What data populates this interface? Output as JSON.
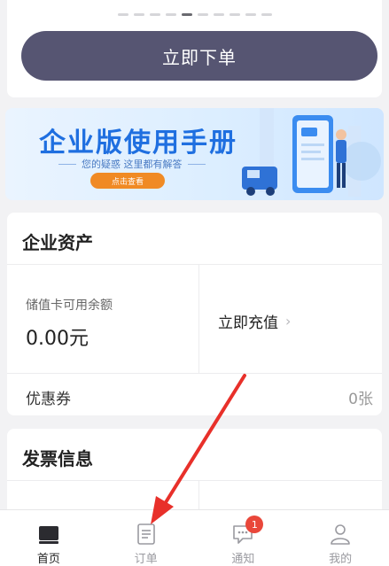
{
  "order": {
    "button_label": "立即下单",
    "pager_count": 10,
    "pager_active": 4
  },
  "banner": {
    "title": "企业版使用手册",
    "subtitle": "您的疑惑 这里都有解答",
    "button_label": "点击查看",
    "colors": {
      "title": "#1f6fe0",
      "button": "#f08a24"
    }
  },
  "assets": {
    "title": "企业资产",
    "balance_label": "储值卡可用余额",
    "balance_value": "0.00元",
    "recharge_label": "立即充值",
    "coupon_label": "优惠券",
    "coupon_value": "0张"
  },
  "invoice": {
    "title": "发票信息"
  },
  "tabbar": {
    "tabs": [
      {
        "label": "首页",
        "icon": "home-icon",
        "active": true
      },
      {
        "label": "订单",
        "icon": "order-document-icon",
        "active": false
      },
      {
        "label": "通知",
        "icon": "chat-bubble-icon",
        "active": false,
        "badge": "1"
      },
      {
        "label": "我的",
        "icon": "user-icon",
        "active": false
      }
    ]
  },
  "colors": {
    "primary_button": "#565572",
    "badge": "#e9473a",
    "arrow": "#e8302a"
  }
}
